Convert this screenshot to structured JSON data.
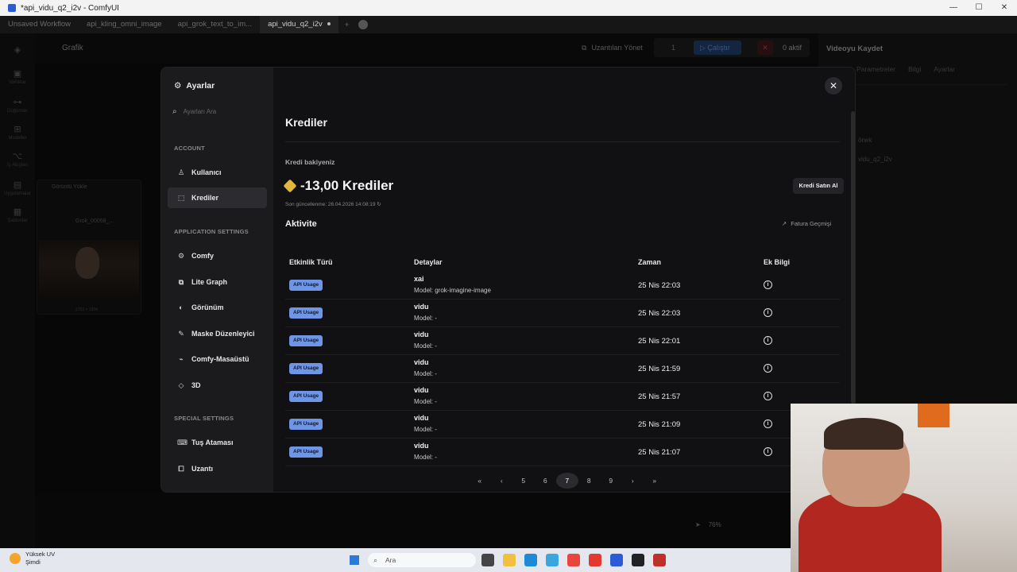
{
  "window": {
    "title": "*api_vidu_q2_i2v - ComfyUI"
  },
  "workflow_tabs": [
    {
      "label": "Unsaved Workflow",
      "active": false
    },
    {
      "label": "api_kling_omni_image",
      "active": false
    },
    {
      "label": "api_grok_text_to_im...",
      "active": false
    },
    {
      "label": "api_vidu_q2_i2v",
      "active": true
    }
  ],
  "toolbar": {
    "graph_label": "Grafik",
    "extensions_label": "Uzantıları Yönet",
    "queue_count": "1",
    "run_label": "Çalıştır",
    "active_label": "0 aktif"
  },
  "left_rail": [
    "Varlıklar",
    "Düğümler",
    "Modeller",
    "İş Akışları",
    "Uygulamalar",
    "Şablonlar"
  ],
  "right_panel": {
    "title": "Videoyu Kaydet",
    "tabs": [
      "Parametreler",
      "Bilgi",
      "Ayarlar"
    ],
    "prefix_label": "önek",
    "prefix_value": "vidu_q2_i2v"
  },
  "background_node": {
    "title": "Görüntü Yükle",
    "file": "Grok_00058_...",
    "dims": "2752 × 1504"
  },
  "settings": {
    "title": "Ayarlar",
    "search_placeholder": "Ayarları Ara",
    "sections": {
      "account": "ACCOUNT",
      "application": "APPLICATION SETTINGS",
      "special": "SPECIAL SETTINGS"
    },
    "account_items": [
      {
        "label": "Kullanıcı",
        "icon": "user-icon"
      },
      {
        "label": "Krediler",
        "icon": "credits-icon",
        "active": true
      }
    ],
    "app_items": [
      {
        "label": "Comfy",
        "icon": "gear-icon"
      },
      {
        "label": "Lite Graph",
        "icon": "graph-icon"
      },
      {
        "label": "Görünüm",
        "icon": "palette-icon"
      },
      {
        "label": "Maske Düzenleyici",
        "icon": "mask-icon"
      },
      {
        "label": "Comfy-Masaüstü",
        "icon": "desktop-icon"
      },
      {
        "label": "3D",
        "icon": "cube-icon"
      }
    ],
    "special_items": [
      {
        "label": "Tuş Ataması",
        "icon": "keyboard-icon"
      },
      {
        "label": "Uzantı",
        "icon": "puzzle-icon"
      }
    ]
  },
  "credits": {
    "title": "Krediler",
    "balance_label": "Kredi bakiyeniz",
    "balance": "-13,00 Krediler",
    "last_updated": "Son güncellenme: 26.04.2026 14:08:19",
    "buy_label": "Kredi Satın Al",
    "activity_title": "Aktivite",
    "invoice_label": "Fatura Geçmişi",
    "columns": [
      "Etkinlik Türü",
      "Detaylar",
      "Zaman",
      "Ek Bilgi"
    ],
    "rows": [
      {
        "type": "API Usage",
        "name": "xai",
        "model": "Model: grok-imagine-image",
        "time": "25 Nis 22:03"
      },
      {
        "type": "API Usage",
        "name": "vidu",
        "model": "Model: -",
        "time": "25 Nis 22:03"
      },
      {
        "type": "API Usage",
        "name": "vidu",
        "model": "Model: -",
        "time": "25 Nis 22:01"
      },
      {
        "type": "API Usage",
        "name": "vidu",
        "model": "Model: -",
        "time": "25 Nis 21:59"
      },
      {
        "type": "API Usage",
        "name": "vidu",
        "model": "Model: -",
        "time": "25 Nis 21:57"
      },
      {
        "type": "API Usage",
        "name": "vidu",
        "model": "Model: -",
        "time": "25 Nis 21:09"
      },
      {
        "type": "API Usage",
        "name": "vidu",
        "model": "Model: -",
        "time": "25 Nis 21:07"
      }
    ],
    "pagination": {
      "first": "«",
      "prev": "‹",
      "next": "›",
      "last": "»",
      "pages": [
        "5",
        "6",
        "7",
        "8",
        "9"
      ],
      "current": "7"
    }
  },
  "canvas_bottom": {
    "zoom": "76%"
  },
  "taskbar": {
    "weather_title": "Yüksek UV",
    "weather_sub": "Şimdi",
    "search_placeholder": "Ara"
  }
}
